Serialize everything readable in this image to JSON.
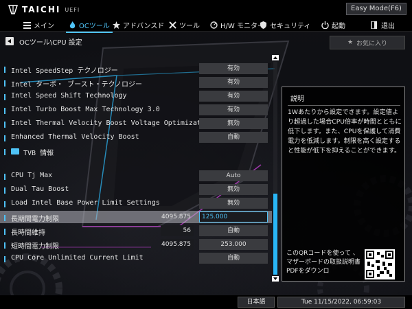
{
  "app": {
    "logo_text": "TAICHI",
    "logo_sub": "UEFI",
    "easy_mode": "Easy Mode(F6)"
  },
  "nav": [
    {
      "label": "メイン",
      "icon": "list-icon"
    },
    {
      "label": "OCツール",
      "icon": "flame-icon",
      "active": true
    },
    {
      "label": "アドバンスド",
      "icon": "star-icon"
    },
    {
      "label": "ツール",
      "icon": "wrench-icon"
    },
    {
      "label": "H/W モニター",
      "icon": "gauge-icon"
    },
    {
      "label": "セキュリティ",
      "icon": "shield-icon"
    },
    {
      "label": "起動",
      "icon": "power-icon"
    },
    {
      "label": "退出",
      "icon": "exit-icon"
    }
  ],
  "breadcrumb": "OCツール\\CPU 設定",
  "favorite_label": "お気に入り",
  "settings": [
    {
      "label": "Intel SpeedStep テクノロジー",
      "value": "有効"
    },
    {
      "label": "Intel ターボ・ ブースト・テクノロジー",
      "value": "有効"
    },
    {
      "label": "Intel Speed Shift Technology",
      "value": "有効"
    },
    {
      "label": "Intel Turbo Boost Max Technology 3.0",
      "value": "有効"
    },
    {
      "label": "Intel Thermal Velocity Boost Voltage Optimizations",
      "value": "無効"
    },
    {
      "label": "Enhanced Thermal Velocity Boost",
      "value": "自動"
    },
    {
      "label": "TVB 情報",
      "folder": true
    },
    {
      "label": "CPU Tj Max",
      "value": "Auto"
    },
    {
      "label": "Dual Tau Boost",
      "value": "無効"
    },
    {
      "label": "Load Intel Base Power Limit Settings",
      "value": "無効"
    },
    {
      "label": "長期間電力制限",
      "current": "4095.875",
      "edit": "125.000",
      "highlight": true
    },
    {
      "label": "長時間維持",
      "current": "56",
      "value": "自動"
    },
    {
      "label": "短時間電力制限",
      "current": "4095.875",
      "value": "253.000"
    },
    {
      "label": "CPU Core Unlimited Current Limit",
      "value": "自動"
    }
  ],
  "help": {
    "title": "説明",
    "body": "1Wあたりから設定できます。設定値より超過した場合CPU倍率が時間とともに低下します。また、CPUを保護して消費電力を低減します。制限を高く設定すると性能が低下を抑えることができます。",
    "qr_text": "このQRコードを使って 、マザーボードの取扱説明書PDFをダウンロ"
  },
  "status": {
    "language": "日本語",
    "datetime": "Tue 11/15/2022, 06:59:03"
  }
}
